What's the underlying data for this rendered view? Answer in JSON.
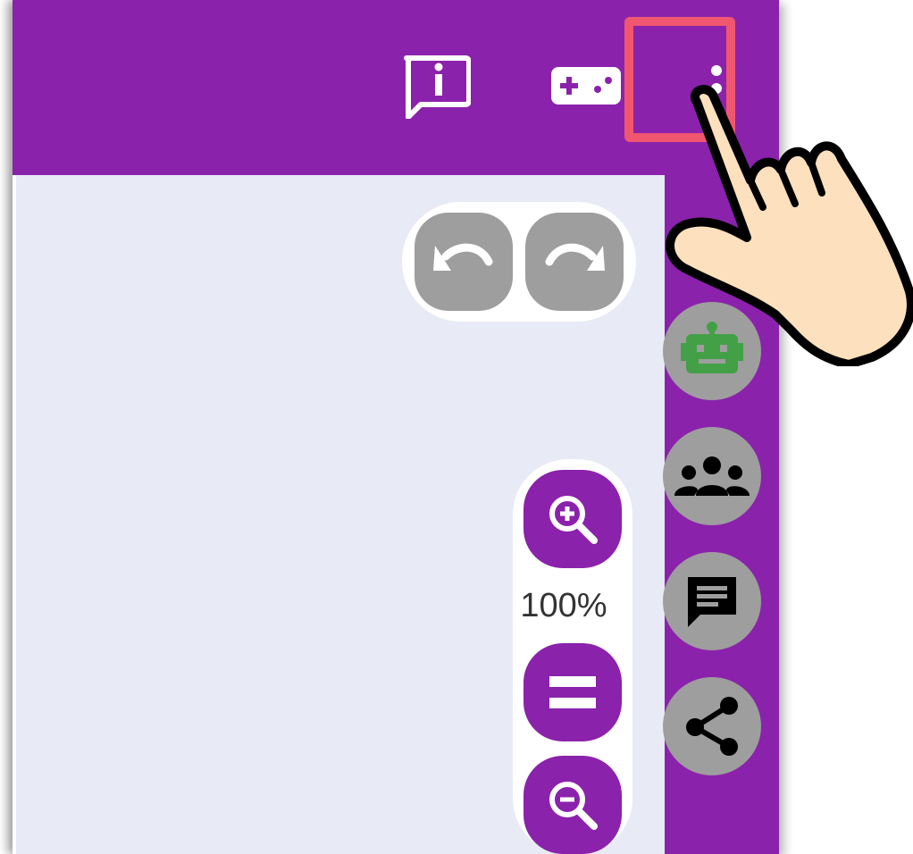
{
  "topbar": {
    "icons": [
      "info-chat-icon",
      "gamepad-icon",
      "more-vert-icon"
    ],
    "color": "#8b22ab"
  },
  "history": {
    "undo_icon": "undo-icon",
    "redo_icon": "redo-icon"
  },
  "zoom": {
    "level": "100%",
    "zoom_in_icon": "zoom-in-icon",
    "reset_icon": "equals-icon",
    "zoom_out_icon": "zoom-out-icon"
  },
  "sidebar": {
    "items": [
      "robot-icon",
      "group-icon",
      "chat-icon",
      "share-icon"
    ]
  },
  "highlight": {
    "color": "#f0566f",
    "target": "more-vert-icon"
  },
  "colors": {
    "primary": "#8b22ab",
    "canvas": "#e8eaf6",
    "button_grey": "#9e9e9e",
    "robot_green": "#43a047"
  }
}
